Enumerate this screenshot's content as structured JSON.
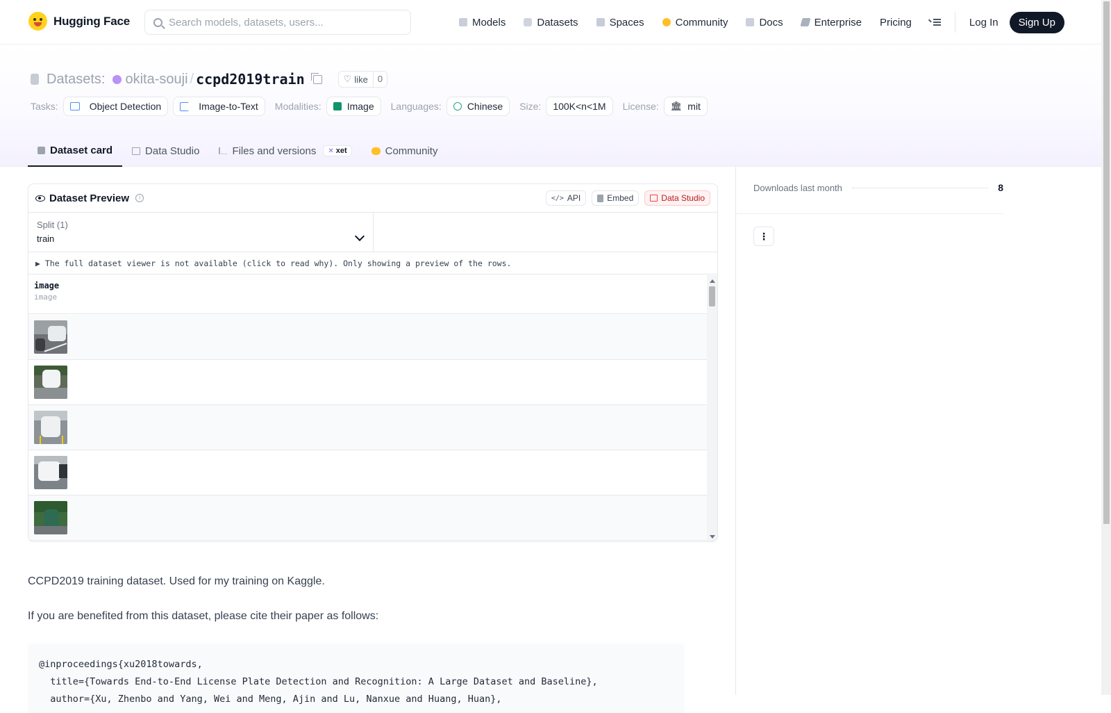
{
  "brand": {
    "name": "Hugging Face"
  },
  "search": {
    "placeholder": "Search models, datasets, users..."
  },
  "nav": {
    "items": [
      "Models",
      "Datasets",
      "Spaces",
      "Community",
      "Docs",
      "Enterprise",
      "Pricing"
    ],
    "login": "Log In",
    "signup": "Sign Up"
  },
  "header": {
    "section": "Datasets:",
    "owner": "okita-souji",
    "separator": "/",
    "name": "ccpd2019train",
    "like_label": "like",
    "like_count": "0"
  },
  "tags": {
    "tasks_label": "Tasks:",
    "tasks": [
      "Object Detection",
      "Image-to-Text"
    ],
    "modalities_label": "Modalities:",
    "modality": "Image",
    "languages_label": "Languages:",
    "language": "Chinese",
    "size_label": "Size:",
    "size": "100K<n<1M",
    "license_label": "License:",
    "license": "mit"
  },
  "tabs": [
    "Dataset card",
    "Data Studio",
    "Files and versions",
    "Community"
  ],
  "xet_label": "xet",
  "viewer": {
    "title": "Dataset Preview",
    "buttons": {
      "api": "API",
      "embed": "Embed",
      "studio": "Data Studio"
    },
    "split_label": "Split (1)",
    "split_value": "train",
    "notice": "The full dataset viewer is not available (click to read why). Only showing a preview of the rows.",
    "column": {
      "name": "image",
      "type": "image"
    },
    "rows": [
      "image-1",
      "image-2",
      "image-3",
      "image-4",
      "image-5"
    ]
  },
  "content": {
    "para1": "CCPD2019 training dataset. Used for my training on Kaggle.",
    "para2": "If you are benefited from this dataset, please cite their paper as follows:",
    "citation": "@inproceedings{xu2018towards,\n  title={Towards End-to-End License Plate Detection and Recognition: A Large Dataset and Baseline},\n  author={Xu, Zhenbo and Yang, Wei and Meng, Ajin and Lu, Nanxue and Huang, Huan},"
  },
  "sidebar": {
    "downloads_label": "Downloads last month",
    "downloads": "8"
  }
}
